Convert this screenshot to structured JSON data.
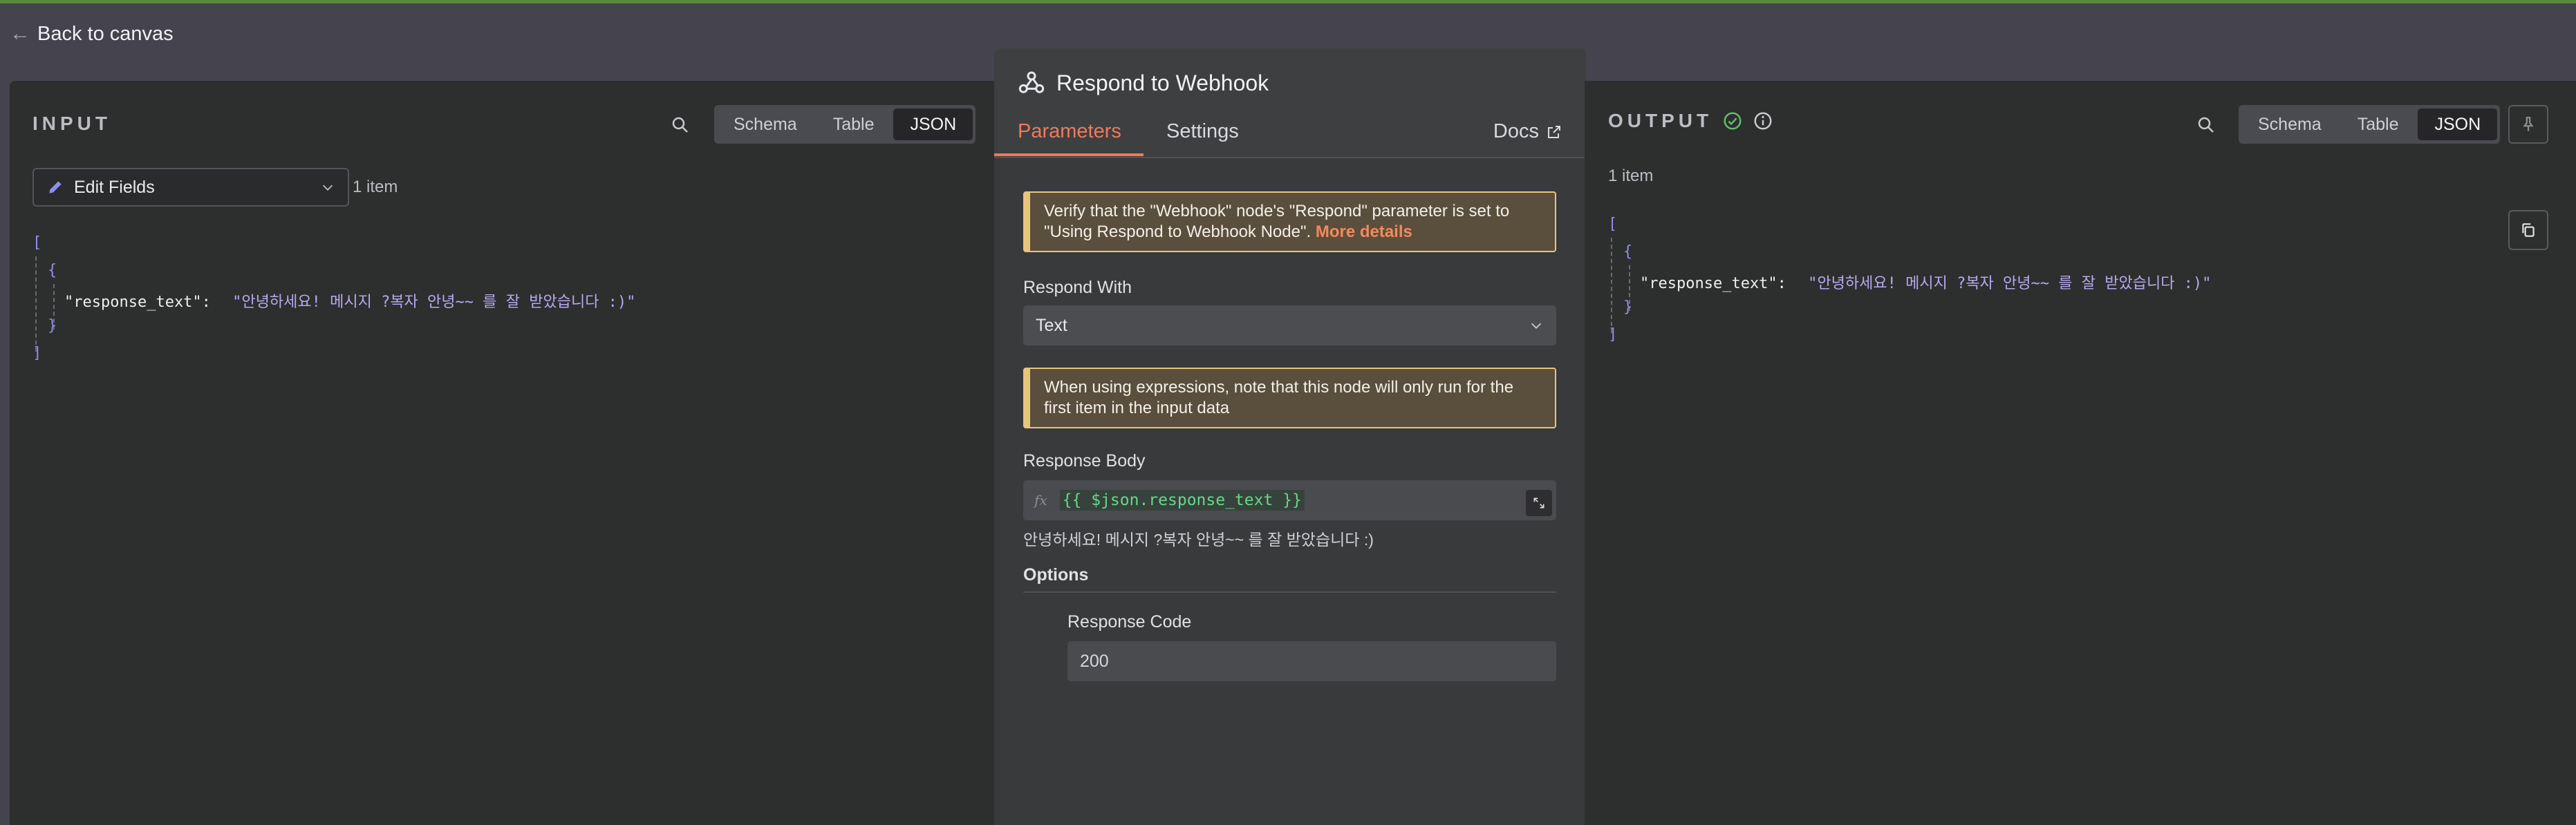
{
  "header": {
    "back_label": "Back to canvas"
  },
  "input_panel": {
    "title": "INPUT",
    "view_options": [
      "Schema",
      "Table",
      "JSON"
    ],
    "active_view": "JSON",
    "source_node": "Edit Fields",
    "item_count": "1 item",
    "json": {
      "open_bracket": "[",
      "open_brace": "{",
      "key": "\"response_text\":",
      "value": "\"안녕하세요! 메시지  ?복자 안녕~~ 를 잘 받았습니다 :)\"",
      "close_brace": "}",
      "close_bracket": "]"
    }
  },
  "node": {
    "title": "Respond to Webhook",
    "tabs": [
      "Parameters",
      "Settings"
    ],
    "active_tab": "Parameters",
    "docs_label": "Docs",
    "notice1": {
      "text": "Verify that the \"Webhook\" node's \"Respond\" parameter is set to \"Using Respond to Webhook Node\".",
      "link": "More details"
    },
    "respond_with_label": "Respond With",
    "respond_with_value": "Text",
    "notice2": "When using expressions, note that this node will only run for the first item in the input data",
    "response_body_label": "Response Body",
    "response_body_fx": "fx",
    "response_body_expression": "{{ $json.response_text }}",
    "response_body_preview": "안녕하세요! 메시지  ?복자 안녕~~ 를 잘 받았습니다 :)",
    "options_label": "Options",
    "response_code_label": "Response Code",
    "response_code_value": "200"
  },
  "output_panel": {
    "title": "OUTPUT",
    "view_options": [
      "Schema",
      "Table",
      "JSON"
    ],
    "active_view": "JSON",
    "item_count": "1 item",
    "json": {
      "open_bracket": "[",
      "open_brace": "{",
      "key": "\"response_text\":",
      "value": "\"안녕하세요! 메시지  ?복자 안녕~~ 를 잘 받았습니다 :)\"",
      "close_brace": "}",
      "close_bracket": "]"
    }
  },
  "colors": {
    "accent": "#ef7a5a",
    "success": "#5fbf6a",
    "warning_border": "#e9c57c",
    "expression_green": "#65d88a"
  }
}
